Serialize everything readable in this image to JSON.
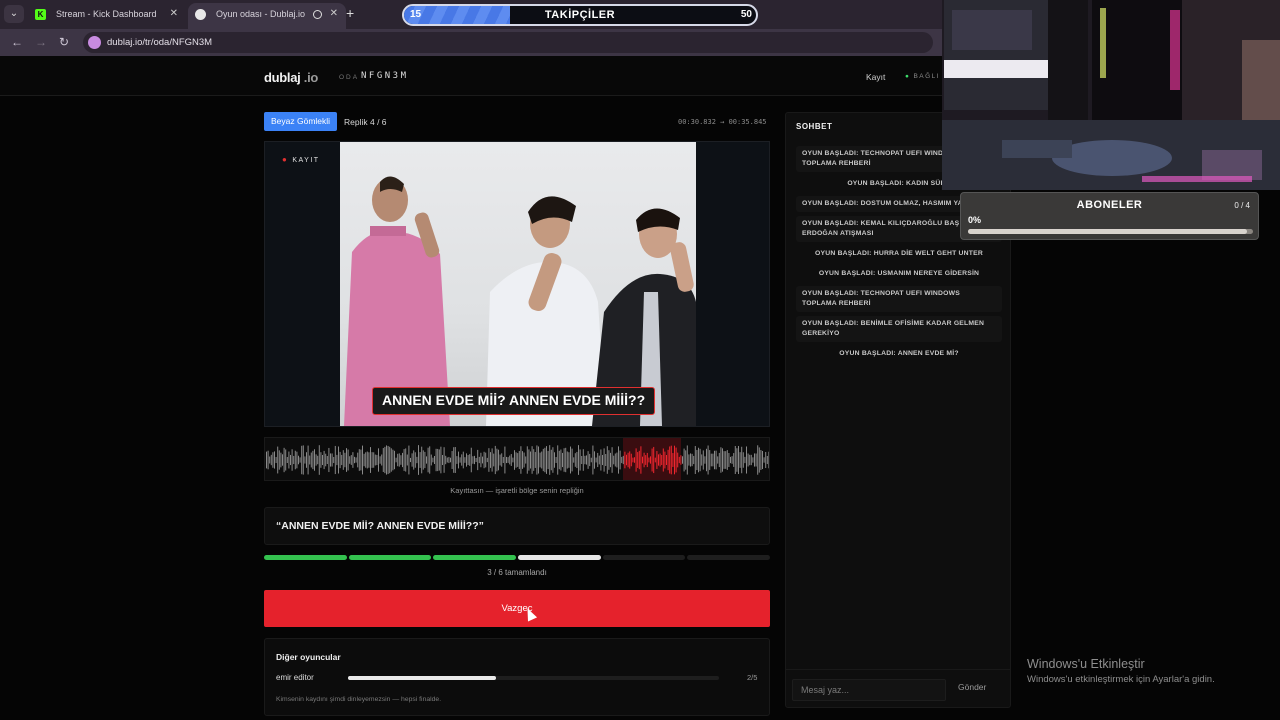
{
  "browser": {
    "tabs": [
      {
        "title": "Stream - Kick Dashboard",
        "active": false
      },
      {
        "title": "Oyun odası - Dublaj.io",
        "active": true
      }
    ],
    "url": "dublaj.io/tr/oda/NFGN3M"
  },
  "site": {
    "logo_main": "dublaj",
    "logo_suffix": ".io",
    "room_label": "ODA",
    "room_code": "NFGN3M",
    "login_link": "Kayıt",
    "status": "BAĞLI"
  },
  "scene": {
    "role": "Beyaz Gömlekli",
    "replik": "Replik 4 / 6",
    "timecode": "00:30.832 → 00:35.845",
    "rec_label": "KAYIT",
    "subtitle": "ANNEN EVDE Mİİ? ANNEN EVDE Mİİİ??",
    "wave_hint": "Kayıttasın — işaretli bölge senin repliğin",
    "quote": "“ANNEN EVDE Mİİ? ANNEN EVDE Mİİİ??”",
    "progress": {
      "done": 3,
      "total": 6,
      "active_index": 3,
      "label": "3 / 6 tamamlandı"
    },
    "cancel_button": "Vazgeç"
  },
  "others": {
    "title": "Diğer oyuncular",
    "players": [
      {
        "name": "emir editor",
        "progress": 0.4,
        "count": "2/5"
      }
    ],
    "note": "Kimsenin kaydını şimdi dinleyemezsin — hepsi finalde."
  },
  "chat": {
    "title": "SOHBET",
    "messages": [
      {
        "text": "OYUN BAŞLADI: TECHNOPAT UEFI WINDOWS TOPLAMA REHBERİ",
        "boxed": true
      },
      {
        "text": "OYUN BAŞLADI: KADIN SÜRÜ",
        "boxed": false
      },
      {
        "text": "OYUN BAŞLADI: DOSTUM OLMAZ, HASMIM YAŞAMAZ.",
        "boxed": true
      },
      {
        "text": "OYUN BAŞLADI: KEMAL KILIÇDAROĞLU BAŞ TAYYİP ERDOĞAN ATIŞMASI",
        "boxed": true
      },
      {
        "text": "OYUN BAŞLADI: HURRA DİE WELT GEHT UNTER",
        "boxed": false
      },
      {
        "text": "OYUN BAŞLADI: USMANIM NEREYE GİDERSİN",
        "boxed": false
      },
      {
        "text": "OYUN BAŞLADI: TECHNOPAT UEFI WINDOWS TOPLAMA REHBERİ",
        "boxed": true
      },
      {
        "text": "OYUN BAŞLADI: BENİMLE OFİSİME KADAR GELMEN GEREKİYO",
        "boxed": true
      },
      {
        "text": "OYUN BAŞLADI: ANNEN EVDE Mİ?",
        "boxed": false
      }
    ],
    "input_placeholder": "Mesaj yaz...",
    "send_button": "Gönder"
  },
  "overlay": {
    "followers": {
      "title": "TAKİPÇİLER",
      "current": "15",
      "goal": "50",
      "fill": 0.3
    },
    "subscribers": {
      "title": "ABONELER",
      "count": "0 / 4",
      "percent": "0%",
      "fill": 0.98
    }
  },
  "windows": {
    "activate_title": "Windows'u Etkinleştir",
    "activate_sub": "Windows'u etkinleştirmek için Ayarlar'a gidin."
  },
  "colors": {
    "accent_red": "#e5222c",
    "done_green": "#34c24f",
    "role_blue": "#3b82f6",
    "kick_green": "#53fc18"
  }
}
